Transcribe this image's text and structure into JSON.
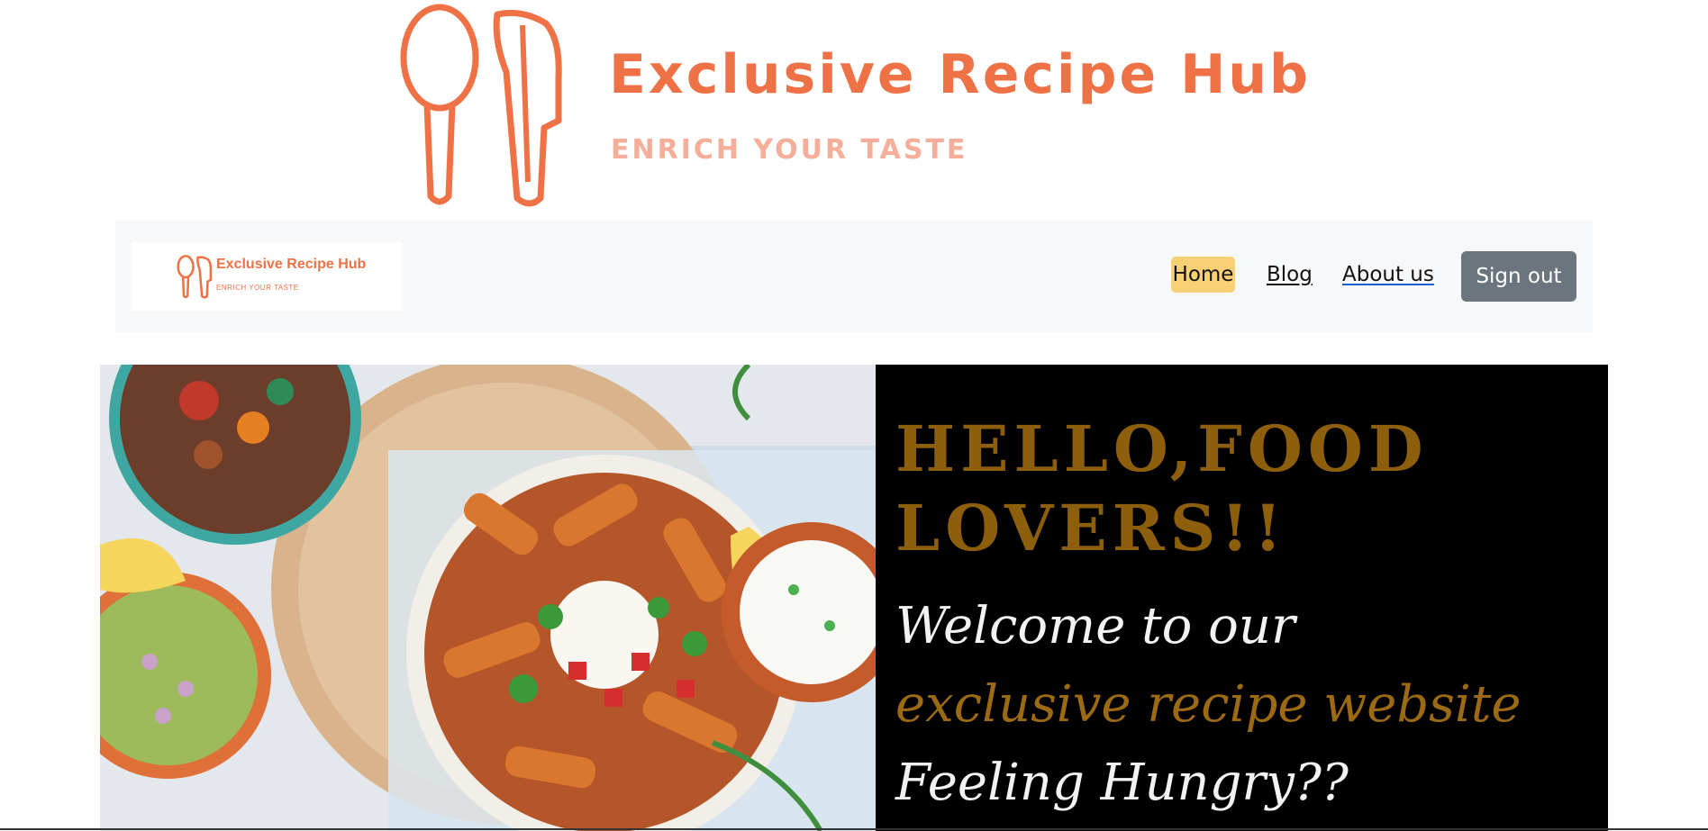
{
  "banner": {
    "title": "Exclusive Recipe Hub",
    "tagline": "ENRICH YOUR TASTE",
    "icon": "spoon-knife-icon",
    "brand_color": "#ef7247",
    "tagline_color": "#f4ae99"
  },
  "navbar": {
    "logo": {
      "title": "Exclusive Recipe Hub",
      "tagline": "ENRICH YOUR TASTE",
      "icon": "spoon-knife-icon"
    },
    "links": {
      "home": "Home",
      "blog": "Blog",
      "about": "About us"
    },
    "active_link": "home",
    "active_color": "#f9d073",
    "signout_label": "Sign out",
    "signout_color": "#6c757d"
  },
  "hero": {
    "image": "food-bowls-photo",
    "heading": "HELLO,FOOD LOVERS!!",
    "welcome": "Welcome to our",
    "site": "exclusive recipe website",
    "hungry": "Feeling Hungry??",
    "accent_color": "#8d5f0c",
    "background": "#000000"
  }
}
